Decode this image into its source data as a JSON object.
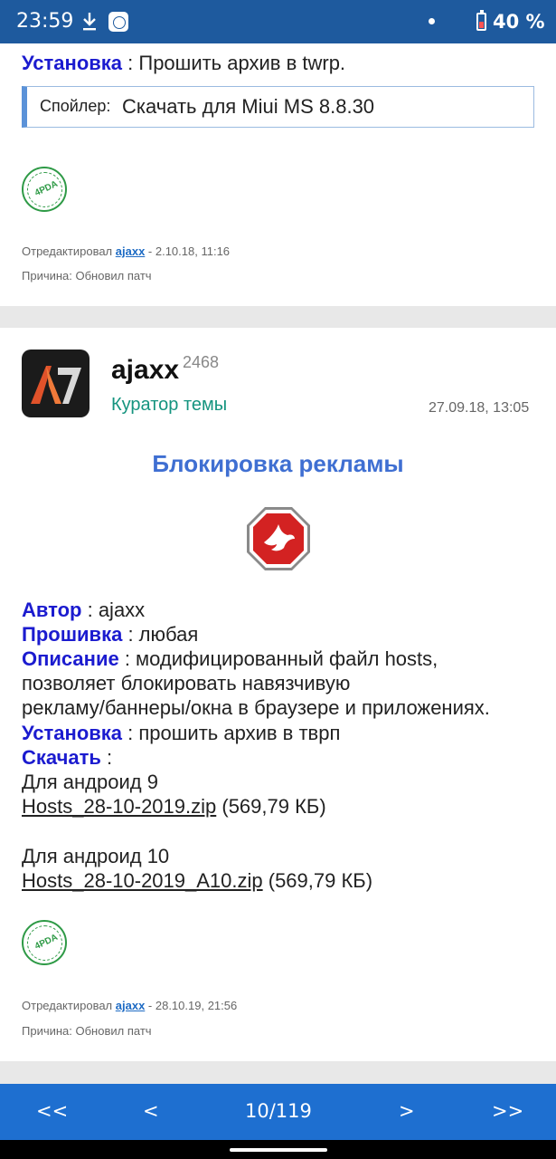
{
  "status_bar": {
    "time": "23:59",
    "battery": "40 %"
  },
  "post1": {
    "install_label": "Установка",
    "install_text": " : Прошить архив в twrp.",
    "spoiler_label": "Спойлер:",
    "spoiler_link": "Скачать для Miui MS 8.8.30",
    "edited_prefix": "Отредактировал ",
    "edited_user": "ajaxx",
    "edited_date": " - 2.10.18, 11:16",
    "reason": "Причина: Обновил патч"
  },
  "post2": {
    "author": "ajaxx",
    "reputation": "2468",
    "role": "Куратор темы",
    "date": "27.09.18, 13:05",
    "heading": "Блокировка рекламы",
    "author_label": "Автор",
    "author_value": " : ajaxx",
    "firmware_label": "Прошивка",
    "firmware_value": " : любая",
    "desc_label": "Описание",
    "desc_value_1": " : модифицированный файл hosts,",
    "desc_value_2": "позволяет блокировать навязчивую",
    "desc_value_3": "рекламу/баннеры/окна в браузере и приложениях.",
    "install_label": "Установка",
    "install_value": " : прошить архив в тврп",
    "download_label": "Скачать",
    "download_value": " :",
    "android9": "Для андроид 9",
    "file1_name": "Hosts_28-10-2019.zip",
    "file1_size": " (569,79 КБ)",
    "android10": "Для андроид 10",
    "file2_name": "Hosts_28-10-2019_A10.zip",
    "file2_size": " (569,79 КБ)",
    "edited_prefix": "Отредактировал ",
    "edited_user": "ajaxx",
    "edited_date": " - 28.10.19, 21:56",
    "reason": "Причина: Обновил патч"
  },
  "pager": {
    "first": "<<",
    "prev": "<",
    "page": "10/119",
    "next": ">",
    "last": ">>"
  }
}
